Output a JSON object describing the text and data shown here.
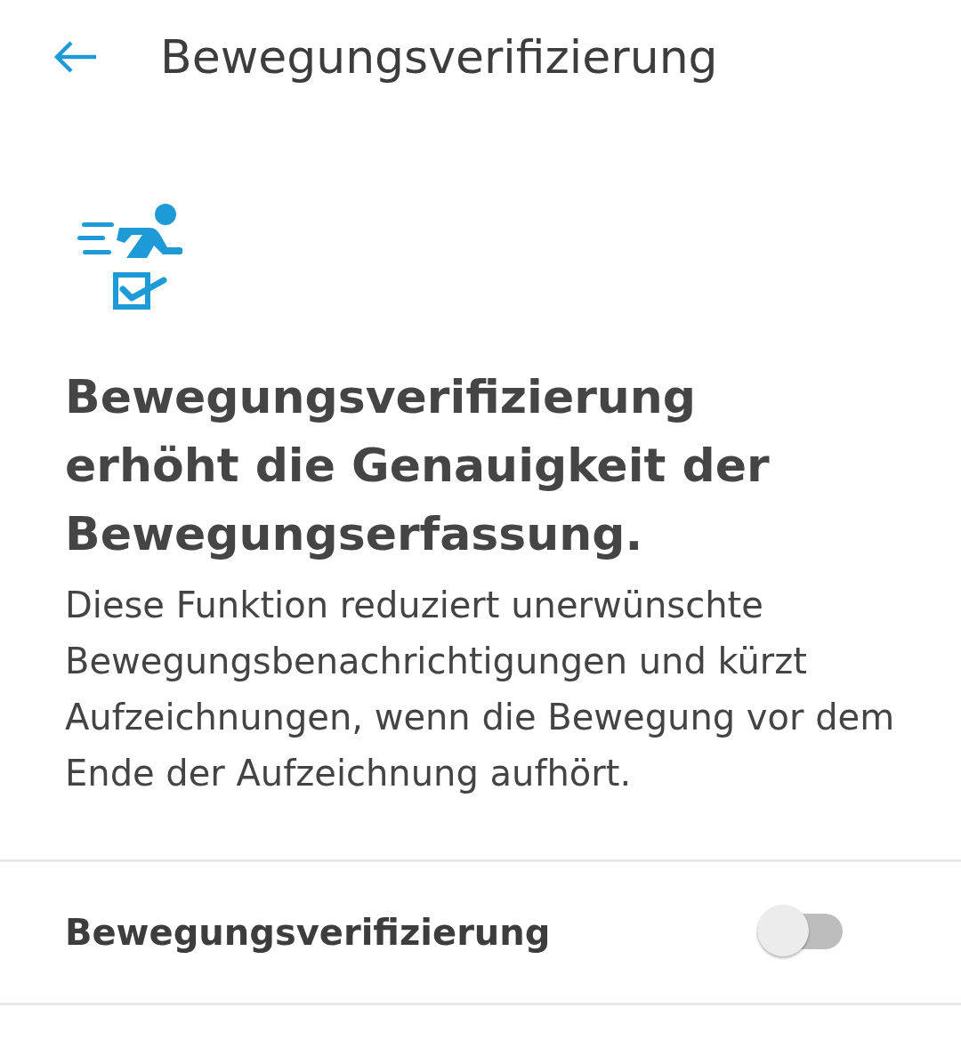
{
  "header": {
    "title": "Bewegungsverifizierung"
  },
  "headline": "Bewegungsverifizierung erhöht die Genauigkeit der Bewegungserfassung.",
  "description": "Diese Funktion reduziert unerwünschte Bewegungsbenachrichtigungen und kürzt Aufzeichnungen, wenn die Bewegung vor dem Ende der Aufzeichnung aufhört.",
  "setting": {
    "label": "Bewegungsverifizierung",
    "on": false
  }
}
